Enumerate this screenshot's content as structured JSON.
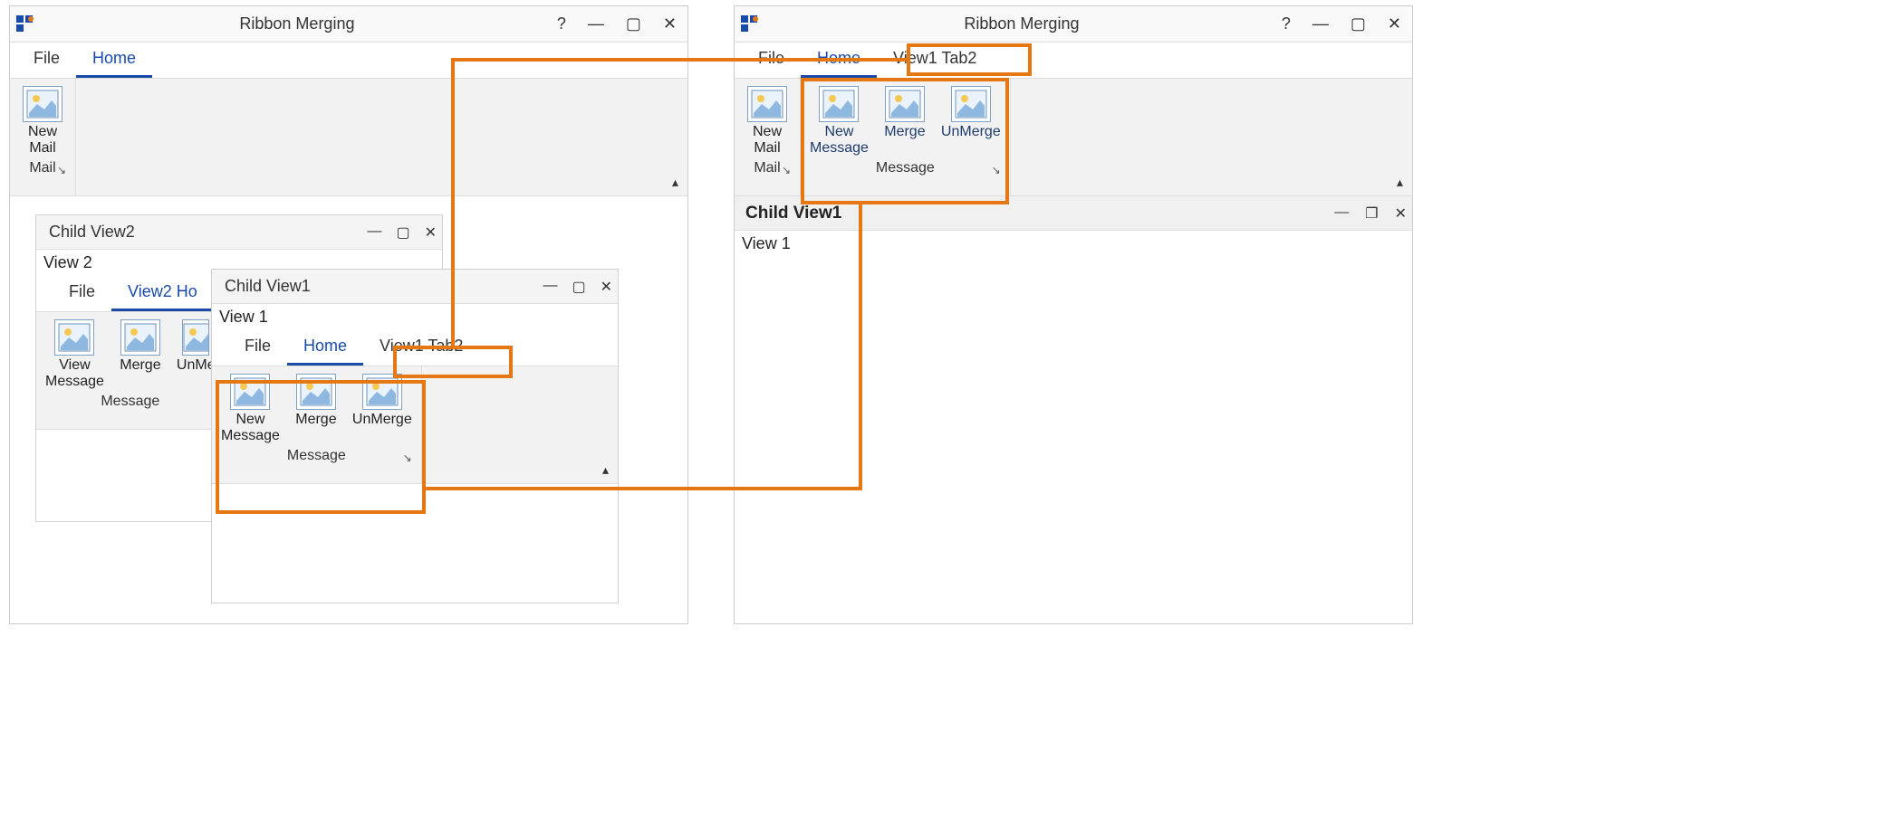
{
  "left_app": {
    "title": "Ribbon Merging",
    "sys": {
      "help": "?",
      "min": "—",
      "max": "▢",
      "close": "✕"
    },
    "tabs": {
      "file": "File",
      "home": "Home"
    },
    "group_mail": {
      "name": "Mail",
      "launcher": "↘",
      "btn_new_mail": "New\nMail"
    },
    "chevron": "▴"
  },
  "child2": {
    "title": "Child View2",
    "sys": {
      "min": "—",
      "max": "▢",
      "close": "✕"
    },
    "body_text": "View 2",
    "tabs": {
      "file": "File",
      "home": "View2 Ho"
    },
    "group_msg": {
      "name": "Message",
      "btn_view_msg": "View\nMessage",
      "btn_merge": "Merge",
      "btn_unmerge": "UnMe"
    }
  },
  "child1": {
    "title": "Child View1",
    "sys": {
      "min": "—",
      "max": "▢",
      "close": "✕"
    },
    "body_text": "View 1",
    "tabs": {
      "file": "File",
      "home": "Home",
      "view1tab2": "View1 Tab2"
    },
    "group_msg": {
      "name": "Message",
      "launcher": "↘",
      "btn_new_msg": "New\nMessage",
      "btn_merge": "Merge",
      "btn_unmerge": "UnMerge"
    },
    "chevron": "▴"
  },
  "right_app": {
    "title": "Ribbon Merging",
    "sys": {
      "help": "?",
      "min": "—",
      "max": "▢",
      "close": "✕"
    },
    "tabs": {
      "file": "File",
      "home": "Home",
      "view1tab2": "View1 Tab2"
    },
    "group_mail": {
      "name": "Mail",
      "launcher": "↘",
      "btn_new_mail": "New\nMail"
    },
    "group_msg": {
      "name": "Message",
      "launcher": "↘",
      "btn_new_msg": "New\nMessage",
      "btn_merge": "Merge",
      "btn_unmerge": "UnMerge"
    },
    "chevron": "▴",
    "mdi": {
      "title": "Child View1",
      "sys": {
        "min": "—",
        "restore": "❐",
        "close": "✕"
      },
      "body_text": "View 1"
    }
  }
}
